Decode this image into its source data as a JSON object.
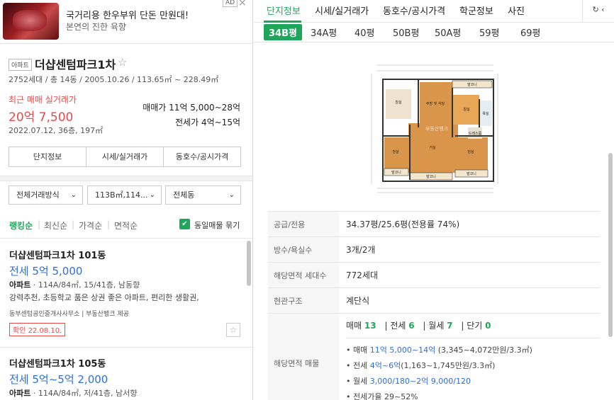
{
  "ad": {
    "title": "국거리용 한우부위 단돈 만원대!",
    "subtitle": "본연의 진한 육향",
    "badge": "AD",
    "close": "×"
  },
  "complex": {
    "type_badge": "아파트",
    "name": "더샵센텀파크1차",
    "info": "2752세대 / 총 14동 / 2005.10.26 / 113.65㎡ ~ 228.49㎡",
    "recent_label": "최근 매매 실거래가",
    "recent_price": "20억 7,500",
    "recent_date": "2022.07.12, 36층, 197㎡",
    "sale_range": "매매가 11억 5,000~28억",
    "lease_range": "전세가 4억~15억",
    "buttons": [
      "단지정보",
      "시세/실거래가",
      "동호수/공시가격"
    ]
  },
  "filters": {
    "deal_type": "전체거래방식",
    "area": "113B㎡,114...",
    "dong": "전체동"
  },
  "sort": {
    "options": [
      "랭킹순",
      "최신순",
      "가격순",
      "면적순"
    ],
    "active": "랭킹순",
    "group_label": "동일매물 묶기"
  },
  "listings": [
    {
      "title": "더샵센텀파크1차 101동",
      "price": "전세 5억 5,000",
      "type": "아파트",
      "spec": " · 114A/84㎡, 15/41층, 남동향",
      "desc": "강력추천, 초등학교 품은 상권 좋은 아파트, 편리한 생활권,",
      "source": "동부센텀공인중개사사무소 | 부동산뱅크 제공",
      "confirm": "확인 22.08.10."
    },
    {
      "title": "더샵센텀파크1차 105동",
      "price": "전세 5억~5억 2,000",
      "type": "아파트",
      "spec": " · 114A/84㎡, 저/41층, 남서향"
    }
  ],
  "tabs": {
    "items": [
      "단지정보",
      "시세/실거래가",
      "동호수/공시가격",
      "학군정보",
      "사진"
    ],
    "active": "단지정보",
    "refresh_icon": "refresh-icon"
  },
  "pyeong_tabs": {
    "items": [
      "34B평",
      "34A평",
      "40평",
      "50B평",
      "50A평",
      "59평",
      "69평"
    ],
    "active": "34B평"
  },
  "floorplan": {
    "rooms": [
      "침실",
      "주방 및 식당",
      "침실",
      "거실",
      "침실",
      "침실",
      "욕실",
      "드레스룸",
      "발코니",
      "발코니",
      "발코니",
      "발코니"
    ],
    "watermark": "부동산뱅크"
  },
  "details": {
    "rows": [
      {
        "key": "공급/전용",
        "value": "34.37평/25.6평(전용률 74%)"
      },
      {
        "key": "방수/욕실수",
        "value": "3개/2개"
      },
      {
        "key": "해당면적 세대수",
        "value": "772세대"
      },
      {
        "key": "현관구조",
        "value": "계단식"
      }
    ],
    "listings_key": "해당면적 매물",
    "counts": [
      {
        "label": "매매",
        "num": "13"
      },
      {
        "label": "전세",
        "num": "6"
      },
      {
        "label": "월세",
        "num": "7"
      },
      {
        "label": "단기",
        "num": "0"
      }
    ],
    "bullets": [
      {
        "label": "매매 ",
        "blue": "11억 5,000~14억",
        "rest": " (3,345~4,072만원/3.3㎡)"
      },
      {
        "label": "전세 ",
        "blue": "4억~6억",
        "rest": "(1,163~1,745만원/3.3㎡)"
      },
      {
        "label": "월세 ",
        "blue": "3,000/180~2억 9,000/120",
        "rest": ""
      },
      {
        "label": "전세가율 29~52%",
        "blue": "",
        "rest": ""
      }
    ]
  },
  "colors": {
    "accent": "#1ea75b",
    "price_red": "#e84a4a",
    "price_blue": "#2f6fd6"
  }
}
